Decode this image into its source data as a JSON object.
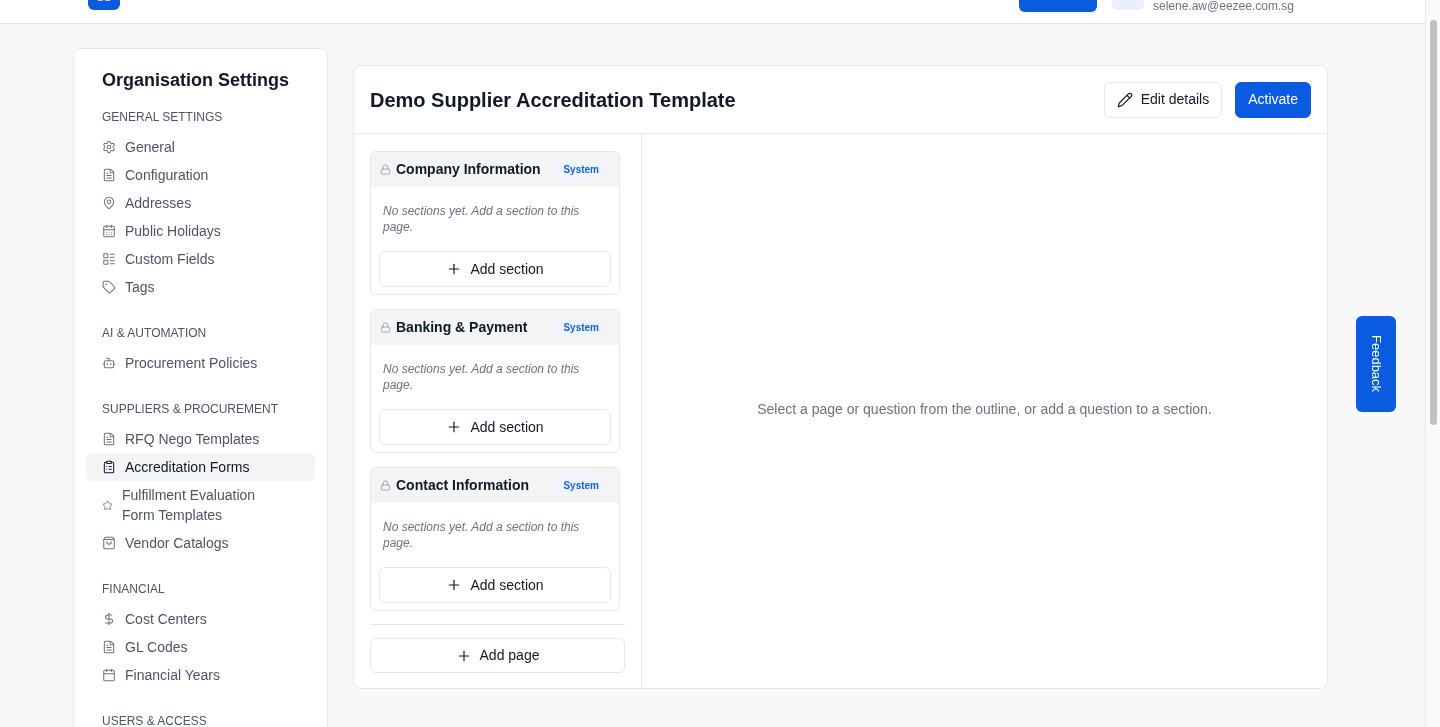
{
  "header": {
    "email": "selene.aw@eezee.com.sg"
  },
  "sidebar": {
    "title": "Organisation Settings",
    "groups": [
      {
        "heading": "GENERAL SETTINGS",
        "items": [
          {
            "label": "General",
            "selected": false
          },
          {
            "label": "Configuration",
            "selected": false
          },
          {
            "label": "Addresses",
            "selected": false
          },
          {
            "label": "Public Holidays",
            "selected": false
          },
          {
            "label": "Custom Fields",
            "selected": false
          },
          {
            "label": "Tags",
            "selected": false
          }
        ]
      },
      {
        "heading": "AI & AUTOMATION",
        "items": [
          {
            "label": "Procurement Policies",
            "selected": false
          }
        ]
      },
      {
        "heading": "SUPPLIERS & PROCUREMENT",
        "items": [
          {
            "label": "RFQ Nego Templates",
            "selected": false
          },
          {
            "label": "Accreditation Forms",
            "selected": true
          },
          {
            "label": "Fulfillment Evaluation Form Templates",
            "selected": false
          },
          {
            "label": "Vendor Catalogs",
            "selected": false
          }
        ]
      },
      {
        "heading": "FINANCIAL",
        "items": [
          {
            "label": "Cost Centers",
            "selected": false
          },
          {
            "label": "GL Codes",
            "selected": false
          },
          {
            "label": "Financial Years",
            "selected": false
          }
        ]
      },
      {
        "heading": "USERS & ACCESS"
      }
    ]
  },
  "template": {
    "title": "Demo Supplier Accreditation Template",
    "actions": [
      {
        "label": "Edit details",
        "kind": "secondary"
      },
      {
        "label": "Activate",
        "kind": "primary"
      }
    ]
  },
  "outline": {
    "pages": [
      {
        "title": "Company Information",
        "locked": true,
        "badge": "System",
        "empty_message": "No sections yet. Add a section to this page.",
        "add_section": "Add section"
      },
      {
        "title": "Banking & Payment",
        "locked": true,
        "badge": "System",
        "empty_message": "No sections yet. Add a section to this page.",
        "add_section": "Add section"
      },
      {
        "title": "Contact Information",
        "locked": true,
        "badge": "System",
        "empty_message": "No sections yet. Add a section to this page.",
        "add_section": "Add section"
      }
    ],
    "add_page": "Add page"
  },
  "detail": {
    "message": "Select a page or question from the outline, or add a question to a section."
  },
  "feedback": {
    "label": "Feedback"
  }
}
